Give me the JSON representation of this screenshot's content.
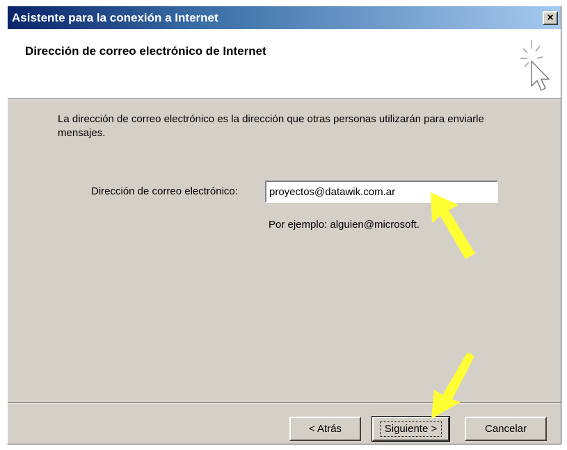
{
  "window": {
    "title": "Asistente para la conexión a Internet",
    "close_glyph": "×"
  },
  "header": {
    "title": "Dirección de correo electrónico de Internet",
    "icon": "wizard-cursor-icon"
  },
  "body": {
    "description": "La dirección de correo electrónico es la dirección que otras personas utilizarán para enviarle mensajes.",
    "email_label": "Dirección de correo electrónico:",
    "email_value": "proyectos@datawik.com.ar",
    "example_text": "Por ejemplo: alguien@microsoft."
  },
  "buttons": {
    "back": "< Atrás",
    "next": "Siguiente >",
    "cancel": "Cancelar"
  },
  "annotations": {
    "arrow_color": "#ffff33",
    "arrows": [
      "yellow-arrow-icon",
      "yellow-arrow-icon"
    ]
  },
  "colors": {
    "title_bar_start": "#0a246a",
    "title_bar_end": "#a6caf0",
    "dialog_face": "#d4d0c8"
  }
}
